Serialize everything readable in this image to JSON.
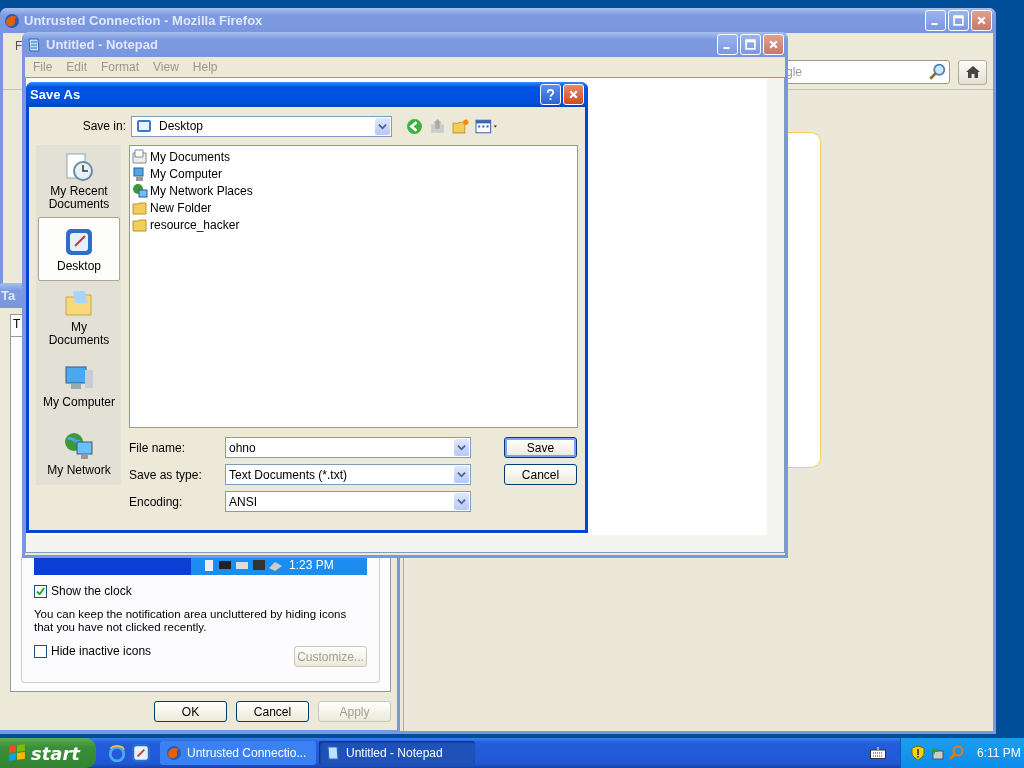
{
  "firefox": {
    "title": "Untrusted Connection - Mozilla Firefox",
    "active": false,
    "menu_fragment": "F",
    "search": {
      "placeholder": "gle"
    }
  },
  "taskbar_properties": {
    "title": "Ta",
    "active": false,
    "tab": "T",
    "preview_clock": "1:23 PM",
    "show_clock": {
      "label": "Show the clock",
      "checked": true
    },
    "note": "You can keep the notification area uncluttered by hiding icons that you have not clicked recently.",
    "hide_inactive": {
      "label": "Hide inactive icons",
      "checked": false
    },
    "customize": {
      "label": "Customize...",
      "disabled": true
    },
    "buttons": [
      {
        "label": "OK",
        "disabled": false
      },
      {
        "label": "Cancel",
        "disabled": false
      },
      {
        "label": "Apply",
        "disabled": true
      }
    ]
  },
  "notepad": {
    "title": "Untitled - Notepad",
    "active": false,
    "menu": [
      "File",
      "Edit",
      "Format",
      "View",
      "Help"
    ]
  },
  "save_as": {
    "title": "Save As",
    "active": true,
    "save_in_label": "Save in:",
    "save_in": "Desktop",
    "places": [
      {
        "label": "My Recent Documents",
        "kind": "recent",
        "selected": false
      },
      {
        "label": "Desktop",
        "kind": "desktop",
        "selected": true
      },
      {
        "label": "My Documents",
        "kind": "documents",
        "selected": false
      },
      {
        "label": "My Computer",
        "kind": "computer",
        "selected": false
      },
      {
        "label": "My Network",
        "kind": "network",
        "selected": false
      }
    ],
    "files": [
      {
        "name": "My Documents",
        "kind": "documents"
      },
      {
        "name": "My Computer",
        "kind": "computer"
      },
      {
        "name": "My Network Places",
        "kind": "network"
      },
      {
        "name": "New Folder",
        "kind": "folder"
      },
      {
        "name": "resource_hacker",
        "kind": "folder"
      }
    ],
    "fields": [
      {
        "label": "File name:",
        "value": "ohno"
      },
      {
        "label": "Save as type:",
        "value": "Text Documents (*.txt)"
      },
      {
        "label": "Encoding:",
        "value": "ANSI"
      }
    ],
    "buttons": [
      {
        "label": "Save",
        "default": true
      },
      {
        "label": "Cancel",
        "default": false
      }
    ]
  },
  "taskbar": {
    "start": "start",
    "tasks": [
      {
        "label": "Untrusted Connectio...",
        "kind": "firefox",
        "selected": false
      },
      {
        "label": "Untitled - Notepad",
        "kind": "notepad",
        "selected": true
      }
    ],
    "clock": "6:11 PM"
  }
}
